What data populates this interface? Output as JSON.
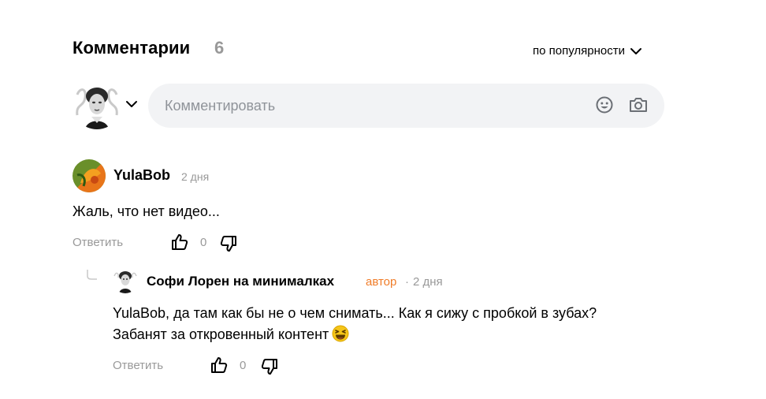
{
  "header": {
    "title": "Комментарии",
    "count": "6",
    "sort_label": "по популярности"
  },
  "composer": {
    "placeholder": "Комментировать",
    "icons": [
      "smile-icon",
      "camera-icon",
      "chevron-down-icon"
    ]
  },
  "comments": [
    {
      "author": "YulaBob",
      "time": "2 дня",
      "text": "Жаль, что нет видео...",
      "reply_label": "Ответить",
      "likes": "0"
    },
    {
      "author": "Софи Лорен на минималках",
      "badge": "автор",
      "separator": "·",
      "time": "2 дня",
      "text_line1": "YulaBob, да там как бы не о чем снимать... Как я сижу с пробкой в зубах?",
      "text_line2": "Забанят за откровенный контент",
      "emoji": "laughing-face-icon",
      "reply_label": "Ответить",
      "likes": "0"
    }
  ],
  "colors": {
    "author_badge": "#f07c28",
    "muted": "#999999",
    "input_bg": "#f2f3f5"
  }
}
